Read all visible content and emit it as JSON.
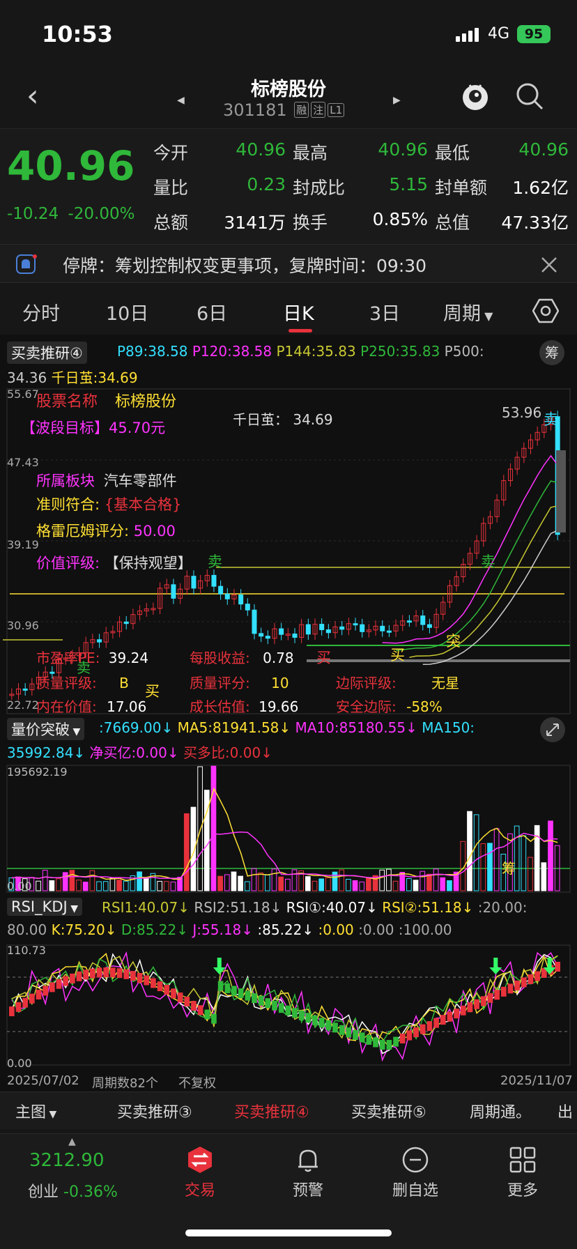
{
  "status": {
    "time": "10:53",
    "network": "4G",
    "battery": "95"
  },
  "nav": {
    "title": "标榜股份",
    "code": "301181",
    "tags": [
      "融",
      "注",
      "L1"
    ]
  },
  "quote": {
    "price": "40.96",
    "change": "-10.24",
    "change_pct": "-20.00%",
    "rows": [
      [
        {
          "label": "今开",
          "value": "40.96"
        },
        {
          "label": "最高",
          "value": "40.96"
        },
        {
          "label": "最低",
          "value": "40.96"
        }
      ],
      [
        {
          "label": "量比",
          "value": "0.23"
        },
        {
          "label": "封成比",
          "value": "5.15"
        },
        {
          "label": "封单额",
          "value": "1.62亿"
        }
      ],
      [
        {
          "label": "总额",
          "value": "3141万"
        },
        {
          "label": "换手",
          "value": "0.85%"
        },
        {
          "label": "总值",
          "value": "47.33亿"
        }
      ]
    ]
  },
  "notice": {
    "text": "停牌：筹划控制权变更事项，复牌时间：09:30"
  },
  "tabs": [
    "分时",
    "10日",
    "6日",
    "日K",
    "3日",
    "周期"
  ],
  "active_tab": "日K",
  "main_chart": {
    "indicator": "买卖推研④",
    "params": [
      "P89:38.58",
      "P120:38.58",
      "P144:35.83",
      "P250:35.83",
      "P500:"
    ],
    "line2": [
      "34.36",
      "千日茧:34.69"
    ],
    "chou_label": "筹",
    "y_labels": [
      "55.67",
      "47.43",
      "39.19",
      "30.96",
      "22.72"
    ],
    "stock_name_label": "股票名称",
    "stock_name": "标榜股份",
    "band_target": "【波段目标】45.70元",
    "qianri": "千日茧：  34.69",
    "peak_value": "53.96",
    "sector_label": "所属板块",
    "sector": "汽车零部件",
    "rule_label": "准则符合:",
    "rule_value": "{基本合格}",
    "graham_label": "格雷厄姆评分:",
    "graham_value": "50.00",
    "value_rating_label": "价值评级:",
    "value_rating": "【保持观望】",
    "pe_label": "市盈率PE:",
    "pe_value": "39.24",
    "eps_label": "每股收益:",
    "eps_value": "0.78",
    "quality_label": "质量评级:",
    "quality_value": "B",
    "quality_score_label": "质量评分:",
    "quality_score": "10",
    "marginal_label": "边际评级:",
    "marginal_value": "无星",
    "intrinsic_label": "内在价值:",
    "intrinsic_value": "17.06",
    "growth_label": "成长估值:",
    "growth_value": "19.66",
    "safety_label": "安全边际:",
    "safety_value": "-58%",
    "signals": {
      "sell": "卖",
      "buy": "买",
      "break": "突"
    }
  },
  "volume_chart": {
    "indicator": "量价突破",
    "line1": [
      ":7669.00↓",
      "MA5:81941.58↓",
      "MA10:85180.55↓",
      "MA150:"
    ],
    "line2": [
      "35992.84↓",
      "净买亿:0.00↓",
      "买多比:0.00↓"
    ],
    "max_label": "195692.19",
    "zero_label": "0.00",
    "mark": "筹"
  },
  "rsi_chart": {
    "indicator": "RSI_KDJ",
    "line1": [
      "RSI1:40.07↓",
      "RSI2:51.18↓",
      "RSI①:40.07↓",
      "RSI②:51.18↓",
      ":20.00:"
    ],
    "line2": [
      "80.00",
      "K:75.20↓",
      "D:85.22↓",
      "J:55.18↓",
      ":85.22↓",
      ":0.00",
      ":0.00",
      ":100.00"
    ],
    "max_label": "110.73",
    "min_label": "0.00"
  },
  "date_bar": {
    "start": "2025/07/02",
    "period": "周期数82个",
    "adjust": "不复权",
    "end": "2025/11/07"
  },
  "bottom_tabs": [
    "主图",
    "买卖推研③",
    "买卖推研④",
    "买卖推研⑤",
    "周期通。",
    "出"
  ],
  "footer": {
    "index_value": "3212.90",
    "index_name": "创业",
    "index_change": "-0.36%",
    "items": [
      "交易",
      "预警",
      "删自选",
      "更多"
    ]
  },
  "colors": {
    "up": "#e8323c",
    "down": "#2fb83a",
    "accent": "#e8323c",
    "yellow": "#ffe033",
    "magenta": "#ff33ff",
    "cyan": "#33e0ff"
  }
}
